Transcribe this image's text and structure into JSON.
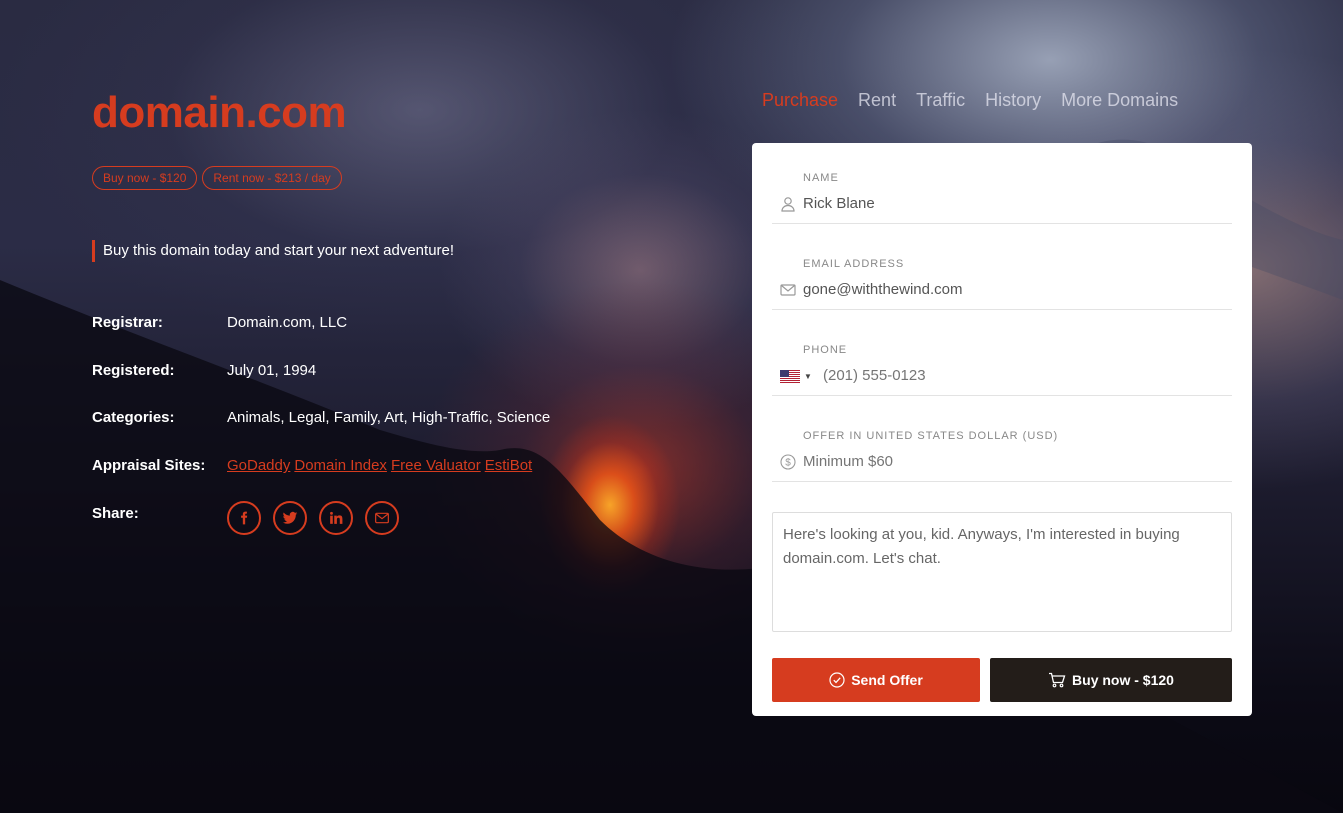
{
  "brand": {
    "title": "domain.com"
  },
  "pills": {
    "buy": "Buy now - $120",
    "rent": "Rent now - $213 / day"
  },
  "tagline": "Buy this domain today and start your next adventure!",
  "details": {
    "registrar_label": "Registrar:",
    "registrar_value": "Domain.com, LLC",
    "registered_label": "Registered:",
    "registered_value": "July 01, 1994",
    "categories_label": "Categories:",
    "categories_value": "Animals, Legal, Family, Art, High-Traffic, Science",
    "appraisal_label": "Appraisal Sites:",
    "appraisal_links": [
      "GoDaddy",
      "Domain Index",
      "Free Valuator",
      "EstiBot"
    ],
    "share_label": "Share:",
    "share_icons": [
      "facebook-icon",
      "twitter-icon",
      "linkedin-icon",
      "email-icon"
    ]
  },
  "nav": {
    "items": [
      "Purchase",
      "Rent",
      "Traffic",
      "History",
      "More Domains"
    ],
    "active": "Purchase"
  },
  "form": {
    "name_label": "Name",
    "name_value": "Rick Blane",
    "email_label": "Email Address",
    "email_value": "gone@withthewind.com",
    "phone_label": "Phone",
    "phone_placeholder": "(201) 555-0123",
    "phone_country": "US",
    "offer_label": "Offer in United States Dollar (USD)",
    "offer_placeholder": "Minimum $60",
    "message_value": "Here's looking at you, kid. Anyways, I'm interested in buying domain.com. Let's chat.",
    "send_label": "Send Offer",
    "buy_label": "Buy now - $120"
  },
  "colors": {
    "accent": "#d63c1f",
    "dark_button": "#231d19"
  }
}
